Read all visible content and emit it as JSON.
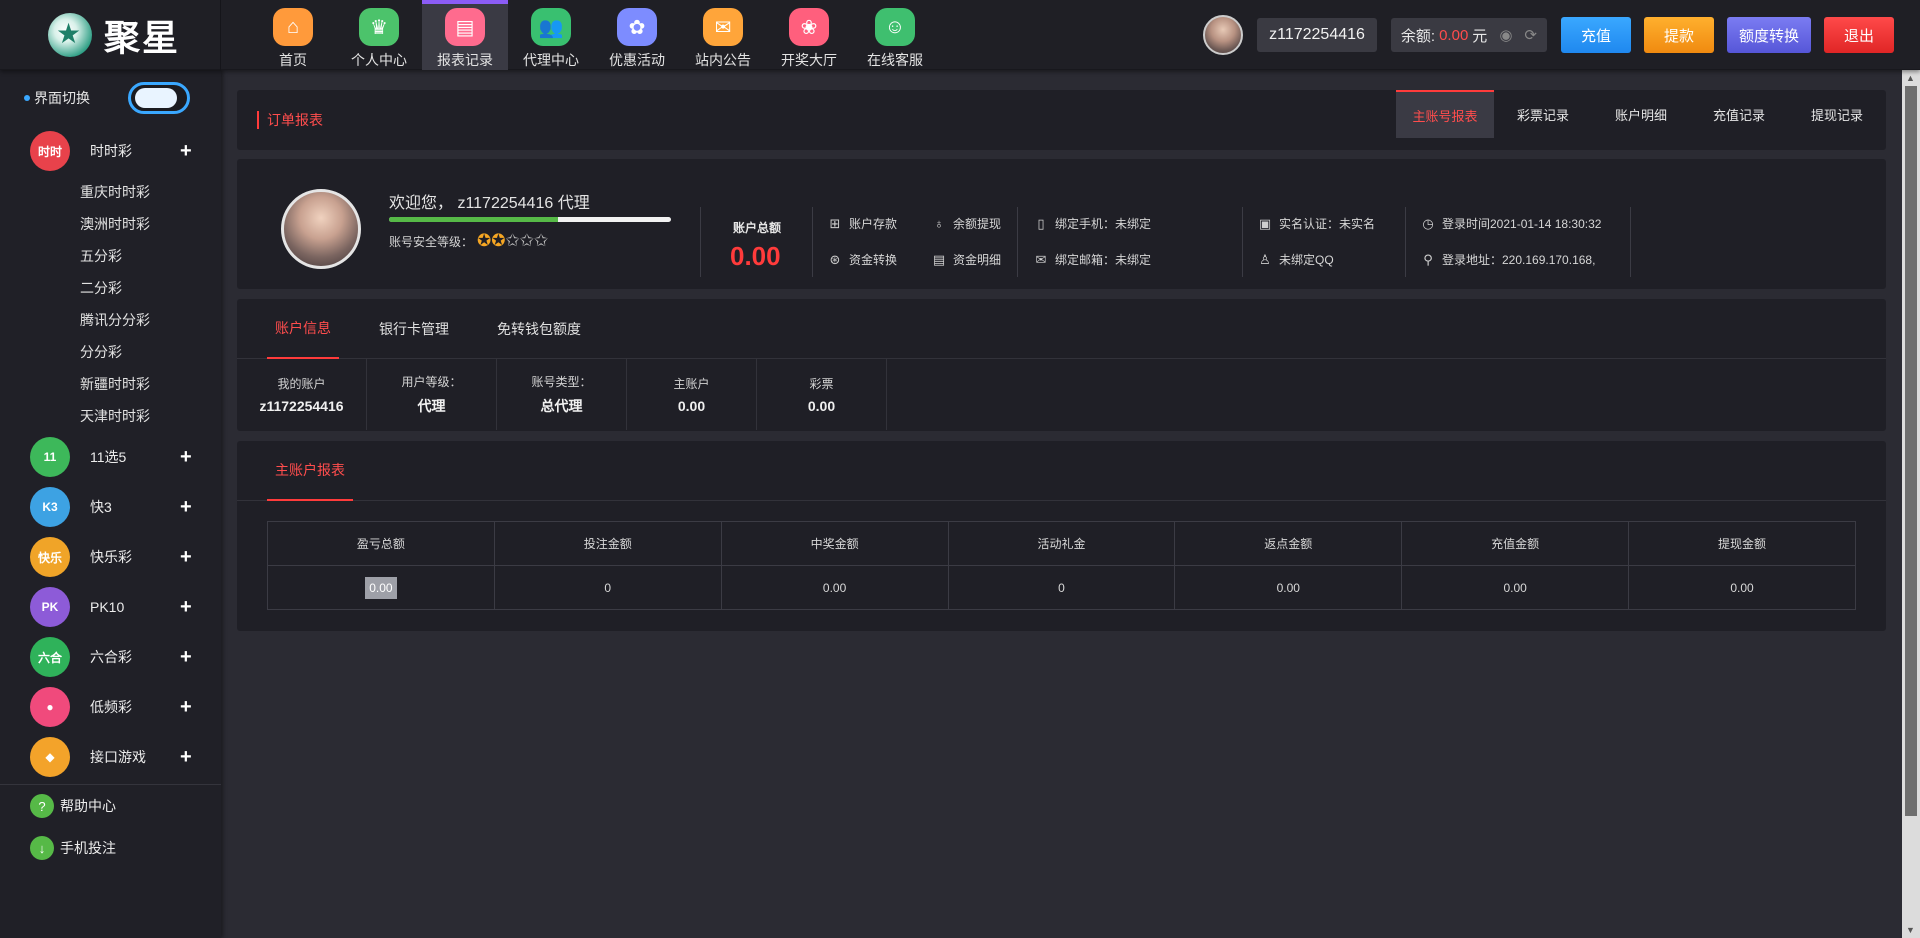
{
  "logo": {
    "text": "聚星"
  },
  "nav": [
    {
      "label": "首页",
      "icon": "home-icon",
      "color": "#ff9a3b",
      "glyph": "⌂",
      "active": false
    },
    {
      "label": "个人中心",
      "icon": "crown-icon",
      "color": "#4cc36b",
      "glyph": "♛",
      "active": false
    },
    {
      "label": "报表记录",
      "icon": "report-icon",
      "color": "#ff6b8e",
      "glyph": "▤",
      "active": true
    },
    {
      "label": "代理中心",
      "icon": "agent-icon",
      "color": "#39c070",
      "glyph": "👥",
      "active": false
    },
    {
      "label": "优惠活动",
      "icon": "gift-icon",
      "color": "#7d8cff",
      "glyph": "✿",
      "active": false
    },
    {
      "label": "站内公告",
      "icon": "mail-icon",
      "color": "#ffa53a",
      "glyph": "✉",
      "active": false
    },
    {
      "label": "开奖大厅",
      "icon": "draw-icon",
      "color": "#ff5f7d",
      "glyph": "❀",
      "active": false
    },
    {
      "label": "在线客服",
      "icon": "support-icon",
      "color": "#3fbf6f",
      "glyph": "☺",
      "active": false
    }
  ],
  "header": {
    "username": "z1172254416",
    "balance_label": "余额:",
    "balance_value": "0.00",
    "balance_unit": "元",
    "buttons": {
      "recharge": "充值",
      "withdraw": "提款",
      "transfer": "额度转换",
      "logout": "退出"
    }
  },
  "sidebar": {
    "switch_label": "界面切换",
    "categories": [
      {
        "label": "时时彩",
        "icon": "ssc-icon",
        "color": "#e8424b",
        "badge": "时时",
        "expanded": true,
        "items": [
          "重庆时时彩",
          "澳洲时时彩",
          "五分彩",
          "二分彩",
          "腾讯分分彩",
          "分分彩",
          "新疆时时彩",
          "天津时时彩"
        ]
      },
      {
        "label": "11选5",
        "icon": "eleven-five-icon",
        "color": "#3db85a",
        "badge": "11",
        "expanded": false,
        "items": []
      },
      {
        "label": "快3",
        "icon": "k3-icon",
        "color": "#3da2e3",
        "badge": "K3",
        "expanded": false,
        "items": []
      },
      {
        "label": "快乐彩",
        "icon": "happy-icon",
        "color": "#f0a428",
        "badge": "快乐",
        "expanded": false,
        "items": []
      },
      {
        "label": "PK10",
        "icon": "pk10-icon",
        "color": "#8d5bd8",
        "badge": "PK",
        "expanded": false,
        "items": []
      },
      {
        "label": "六合彩",
        "icon": "six-icon",
        "color": "#2fb25a",
        "badge": "六合",
        "expanded": false,
        "items": []
      },
      {
        "label": "低频彩",
        "icon": "low-freq-icon",
        "color": "#f04a7c",
        "badge": "●",
        "expanded": false,
        "items": []
      },
      {
        "label": "接口游戏",
        "icon": "api-game-icon",
        "color": "#f3a32a",
        "badge": "◆",
        "expanded": false,
        "items": []
      }
    ],
    "bottom": [
      {
        "label": "帮助中心",
        "icon": "help-icon",
        "glyph": "?"
      },
      {
        "label": "手机投注",
        "icon": "download-icon",
        "glyph": "↓"
      }
    ]
  },
  "order_panel": {
    "title": "订单报表",
    "tabs": [
      "主账号报表",
      "彩票记录",
      "账户明细",
      "充值记录",
      "提现记录"
    ],
    "active_tab": 0
  },
  "profile": {
    "welcome": "欢迎您， z1172254416 代理",
    "security_label": "账号安全等级：",
    "security_level": 2,
    "security_max": 5,
    "progress": 0.6,
    "total_label": "账户总额",
    "total_value": "0.00",
    "actions": [
      {
        "label": "账户存款",
        "icon": "deposit-icon",
        "glyph": "⊞"
      },
      {
        "label": "余额提现",
        "icon": "withdraw-icon",
        "glyph": "♁"
      },
      {
        "label": "资金转换",
        "icon": "exchange-icon",
        "glyph": "⊛"
      },
      {
        "label": "资金明细",
        "icon": "detail-icon",
        "glyph": "▤"
      }
    ],
    "bindings": {
      "phone": "绑定手机：未绑定",
      "email": "绑定邮箱：未绑定",
      "realname": "实名认证：未实名",
      "qq": "未绑定QQ",
      "login_time": "登录时间2021-01-14 18:30:32",
      "login_ip": "登录地址：220.169.170.168,"
    }
  },
  "account_panel": {
    "tabs": [
      "账户信息",
      "银行卡管理",
      "免转钱包额度"
    ],
    "active_tab": 0,
    "cells": [
      {
        "label": "我的账户",
        "value": "z1172254416"
      },
      {
        "label": "用户等级：",
        "value": "代理"
      },
      {
        "label": "账号类型：",
        "value": "总代理"
      },
      {
        "label": "主账户",
        "value": "0.00"
      },
      {
        "label": "彩票",
        "value": "0.00"
      }
    ]
  },
  "report_panel": {
    "tab": "主账户报表",
    "columns": [
      "盈亏总额",
      "投注金额",
      "中奖金额",
      "活动礼金",
      "返点金额",
      "充值金额",
      "提现金额"
    ],
    "row": [
      "0.00",
      "0",
      "0.00",
      "0",
      "0.00",
      "0.00",
      "0.00"
    ]
  }
}
